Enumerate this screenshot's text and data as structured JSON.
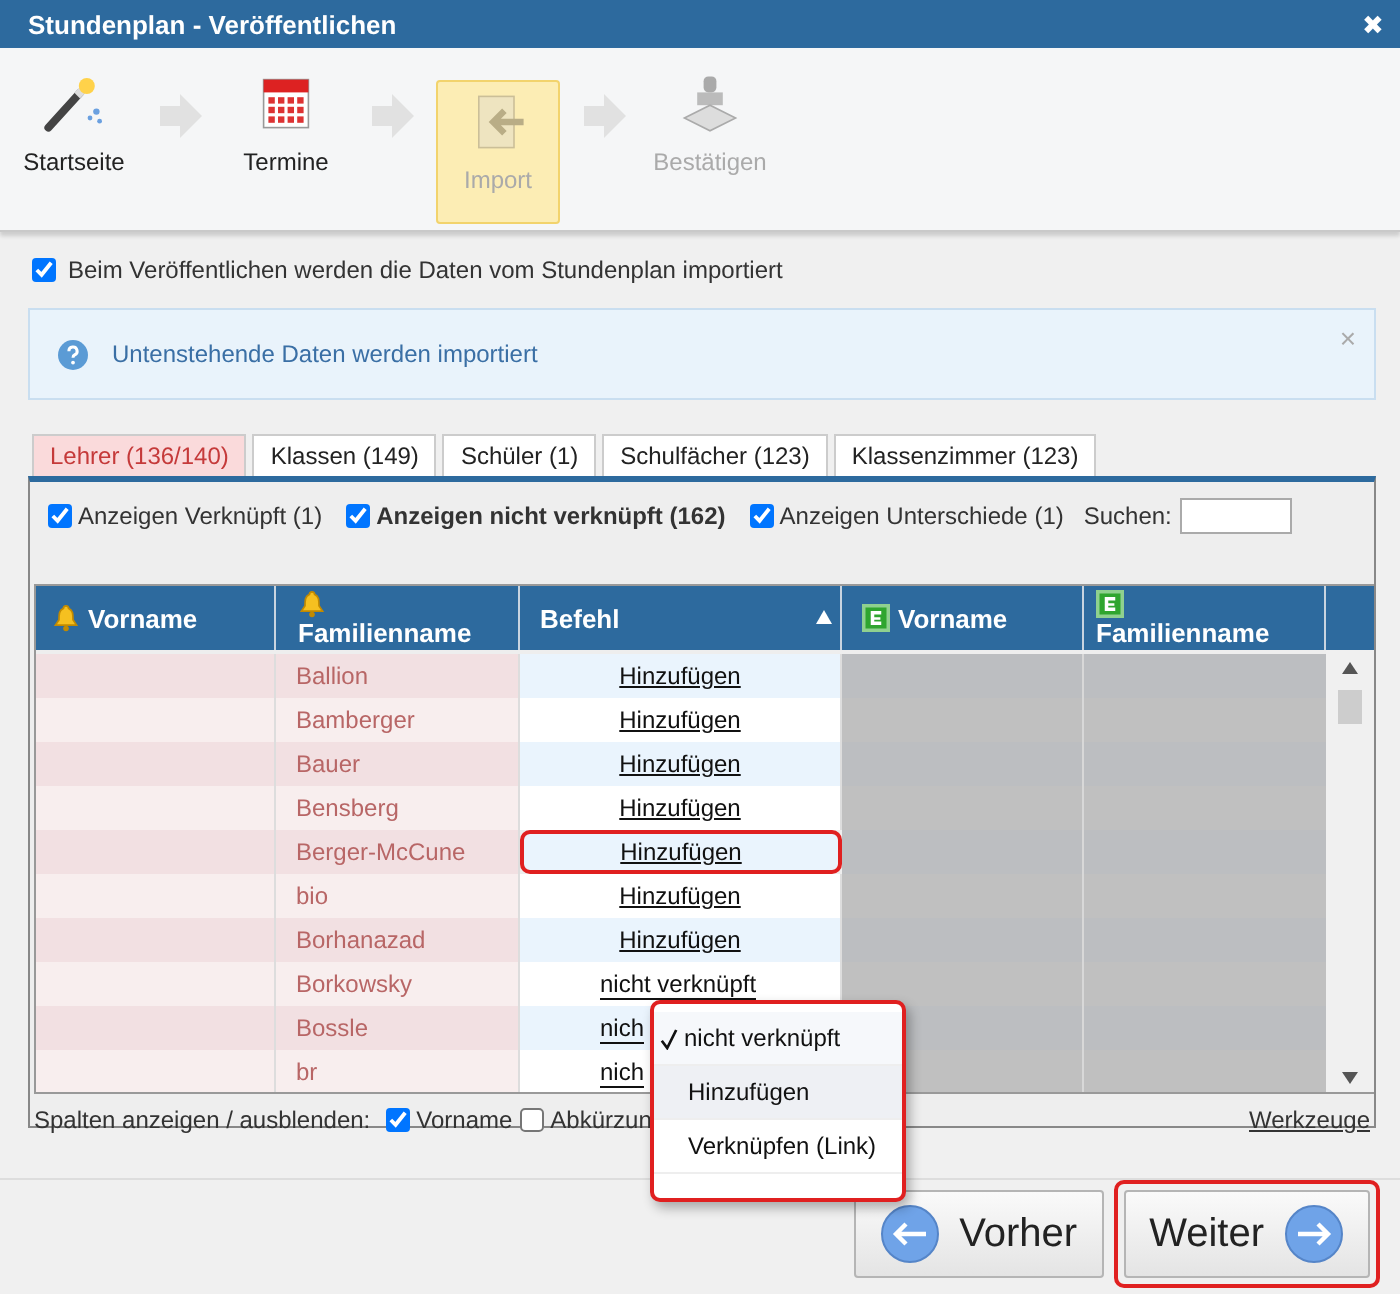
{
  "window": {
    "title": "Stundenplan - Veröffentlichen",
    "close": "✖"
  },
  "steps": [
    {
      "label": "Startseite",
      "kind": "wand",
      "selected": false,
      "disabled": false
    },
    {
      "label": "Termine",
      "kind": "calendar",
      "selected": false,
      "disabled": false
    },
    {
      "label": "Import",
      "kind": "import",
      "selected": true,
      "disabled": true
    },
    {
      "label": "Bestätigen",
      "kind": "stamp",
      "selected": false,
      "disabled": true
    }
  ],
  "import_option": {
    "label": "Beim Veröffentlichen werden die Daten vom Stundenplan importiert",
    "checked": true
  },
  "info": {
    "text": "Untenstehende Daten werden importiert",
    "close": "×"
  },
  "tabs": [
    {
      "label": "Lehrer (136/140)",
      "selected": true
    },
    {
      "label": "Klassen (149)",
      "selected": false
    },
    {
      "label": "Schüler (1)",
      "selected": false
    },
    {
      "label": "Schulfächer (123)",
      "selected": false
    },
    {
      "label": "Klassenzimmer (123)",
      "selected": false
    }
  ],
  "filters": [
    {
      "label": "Anzeigen Verknüpft (1)",
      "checked": true,
      "bold": false
    },
    {
      "label": "Anzeigen nicht verknüpft (162)",
      "checked": true,
      "bold": true
    },
    {
      "label": "Anzeigen Unterschiede (1)",
      "checked": true,
      "bold": false
    }
  ],
  "search": {
    "label": "Suchen:"
  },
  "table": {
    "columns": [
      {
        "label": "Vorname"
      },
      {
        "label": "Familienname"
      },
      {
        "label": "Befehl",
        "sorted": true
      },
      {
        "label": "Vorname"
      },
      {
        "label": "Familienname"
      }
    ],
    "rows": [
      {
        "family": "Ballion",
        "action": "Hinzufügen",
        "kind": "link",
        "highlighted": false
      },
      {
        "family": "Bamberger",
        "action": "Hinzufügen",
        "kind": "link",
        "highlighted": false
      },
      {
        "family": "Bauer",
        "action": "Hinzufügen",
        "kind": "link",
        "highlighted": false
      },
      {
        "family": "Bensberg",
        "action": "Hinzufügen",
        "kind": "link",
        "highlighted": false
      },
      {
        "family": "Berger-McCune",
        "action": "Hinzufügen",
        "kind": "link",
        "highlighted": true
      },
      {
        "family": "bio",
        "action": "Hinzufügen",
        "kind": "link",
        "highlighted": false
      },
      {
        "family": "Borhanazad",
        "action": "Hinzufügen",
        "kind": "link",
        "highlighted": false
      },
      {
        "family": "Borkowsky",
        "action": "nicht verknüpft",
        "kind": "select",
        "highlighted": false
      },
      {
        "family": "Bossle",
        "action": "nich",
        "kind": "select",
        "highlighted": false
      },
      {
        "family": "br",
        "action": "nich",
        "kind": "select",
        "highlighted": false
      }
    ]
  },
  "columns_toggle": {
    "label": "Spalten anzeigen / ausblenden:",
    "options": [
      {
        "label": "Vorname",
        "checked": true
      },
      {
        "label": "Abkürzun",
        "checked": false
      }
    ]
  },
  "tools_link": "Werkzeuge",
  "dropdown": {
    "items": [
      {
        "label": "nicht verknüpft",
        "selected": true
      },
      {
        "label": "Hinzufügen",
        "selected": false
      },
      {
        "label": "Verknüpfen (Link)",
        "selected": false
      }
    ]
  },
  "buttons": [
    {
      "label": "Vorher",
      "kind": "back",
      "highlighted": false
    },
    {
      "label": "Weiter",
      "kind": "next",
      "highlighted": true
    }
  ]
}
